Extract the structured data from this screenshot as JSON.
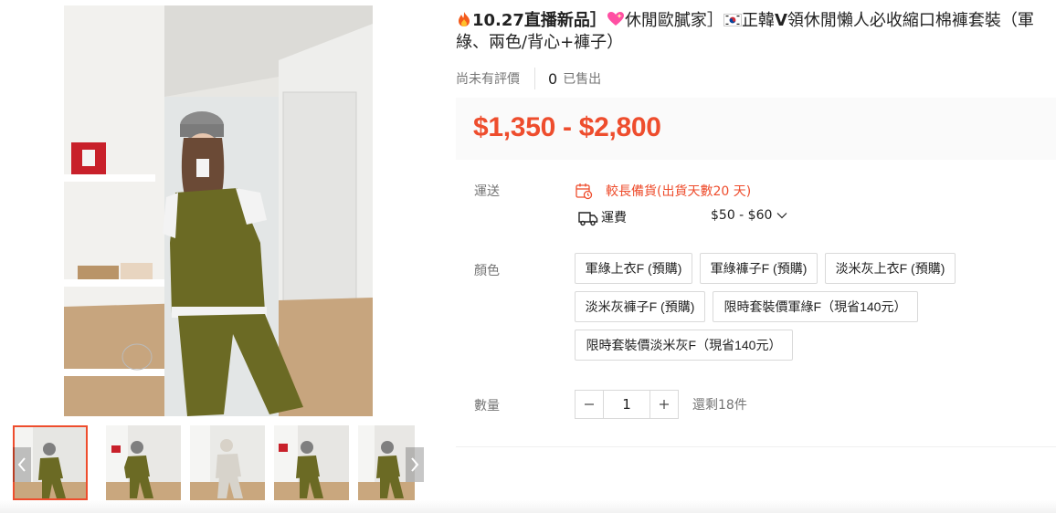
{
  "product": {
    "title_parts": {
      "p1": "10.27直播新品］",
      "p2": "休閒歐膩家］",
      "p3": "正韓",
      "p4": "V",
      "p5": "領休閒懶人必收縮口棉褲套裝（軍綠、兩色/背心+褲子）"
    },
    "title_bold_prefix": "10.27",
    "icons": [
      "fire-emoji",
      "heart-emoji",
      "korea-flag-emoji"
    ]
  },
  "stats": {
    "rating_text": "尚未有評價",
    "sold_count": "0",
    "sold_label": "已售出"
  },
  "price": {
    "range": "$1,350 - $2,800",
    "color": "#ee4d2d"
  },
  "shipping": {
    "label": "運送",
    "notice": "較長備貨(出貨天數20 天)",
    "fee_label": "運費",
    "fee_value": "$50 - $60"
  },
  "color_option": {
    "label": "顏色",
    "options": [
      "軍綠上衣F (預購)",
      "軍綠褲子F (預購)",
      "淡米灰上衣F (預購)",
      "淡米灰褲子F (預購)",
      "限時套裝價軍綠F（現省140元）",
      "限時套裝價淡米灰F（現省140元）"
    ]
  },
  "quantity": {
    "label": "數量",
    "value": "1",
    "stock_text": "還剩18件"
  },
  "gallery": {
    "thumb_count": 5,
    "active_index": 0,
    "accent": "#ee4d2d"
  }
}
